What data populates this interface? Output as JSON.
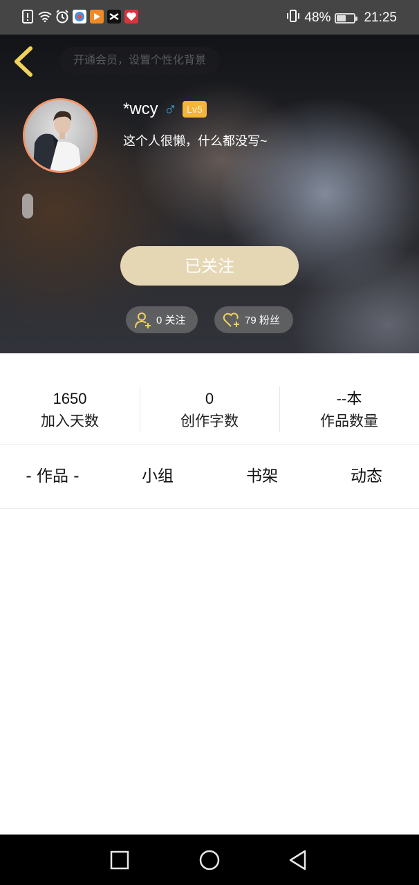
{
  "status_bar": {
    "battery_percent": "48%",
    "time": "21:25",
    "battery_level": 0.48
  },
  "header": {
    "background_hint": "开通会员，设置个性化背景",
    "username": "*wcy",
    "gender_symbol": "♂",
    "level": "Lv5",
    "bio": "这个人很懒，什么都没写~",
    "follow_button": "已关注",
    "following_chip": "0 关注",
    "fans_chip": "79 粉丝"
  },
  "stats": [
    {
      "value": "1650",
      "label": "加入天数"
    },
    {
      "value": "0",
      "label": "创作字数"
    },
    {
      "value": "--本",
      "label": "作品数量"
    }
  ],
  "tabs": [
    {
      "label": "- 作品 -"
    },
    {
      "label": "小组"
    },
    {
      "label": "书架"
    },
    {
      "label": "动态"
    }
  ],
  "colors": {
    "status_bar_bg": "#454545",
    "follow_button_bg": "#e5d7b4",
    "level_badge_bg": "#f5b43a",
    "avatar_ring": "#f2956a",
    "gender_blue": "#3aa9e8",
    "accent_yellow": "#f0d25a"
  },
  "icons": {
    "status_left": [
      "alert-icon",
      "wifi-icon",
      "alarm-icon",
      "app-icon-1",
      "app-icon-2",
      "app-icon-3",
      "app-icon-4"
    ],
    "status_right": [
      "vibrate-icon",
      "battery-icon"
    ],
    "nav": [
      "recent-apps-icon",
      "home-icon",
      "back-icon"
    ]
  }
}
